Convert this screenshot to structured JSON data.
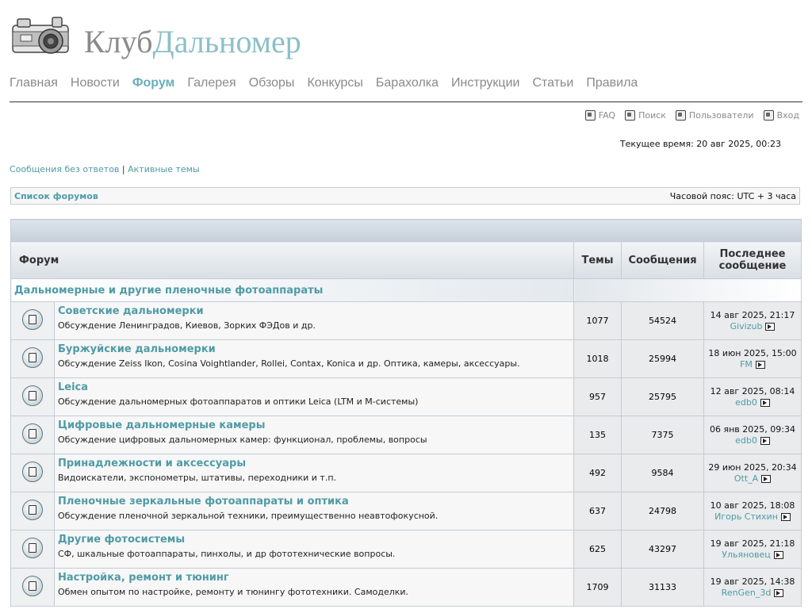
{
  "site": {
    "logo_part1": "Клуб",
    "logo_part2": "Дальномер"
  },
  "nav": [
    {
      "label": "Главная"
    },
    {
      "label": "Новости"
    },
    {
      "label": "Форум",
      "active": true
    },
    {
      "label": "Галерея"
    },
    {
      "label": "Обзоры"
    },
    {
      "label": "Конкурсы"
    },
    {
      "label": "Барахолка"
    },
    {
      "label": "Инструкции"
    },
    {
      "label": "Статьи"
    },
    {
      "label": "Правила"
    }
  ],
  "toplinks": {
    "faq": "FAQ",
    "search": "Поиск",
    "users": "Пользователи",
    "login": "Вход"
  },
  "current_time": "Текущее время: 20 авг 2025, 00:23",
  "quick_links": {
    "unanswered": "Сообщения без ответов",
    "separator": "|",
    "active": "Активные темы"
  },
  "navbar": {
    "forum_list": "Список форумов",
    "timezone": "Часовой пояс: UTC + 3 часа"
  },
  "table": {
    "headers": {
      "forum": "Форум",
      "topics": "Темы",
      "posts": "Сообщения",
      "last_post": "Последнее сообщение"
    },
    "category": "Дальномерные и другие пленочные фотоаппараты",
    "forums": [
      {
        "title": "Советские дальномерки",
        "desc": "Обсуждение Ленинградов, Киевов, Зорких ФЭДов и др.",
        "topics": "1077",
        "posts": "54524",
        "last_date": "14 авг 2025, 21:17",
        "last_user": "Givizub"
      },
      {
        "title": "Буржуйские дальномерки",
        "desc": "Обсуждение Zeiss Ikon, Cosina Voightlander, Rollei, Contax, Konica и др. Оптика, камеры, аксессуары.",
        "topics": "1018",
        "posts": "25994",
        "last_date": "18 июн 2025, 15:00",
        "last_user": "FM"
      },
      {
        "title": "Leica",
        "desc": "Обсуждение дальномерных фотоаппаратов и оптики Leica (LTM и M-системы)",
        "topics": "957",
        "posts": "25795",
        "last_date": "12 авг 2025, 08:14",
        "last_user": "edb0"
      },
      {
        "title": "Цифровые дальномерные камеры",
        "desc": "Обсуждение цифровых дальномерных камер: функционал, проблемы, вопросы",
        "topics": "135",
        "posts": "7375",
        "last_date": "06 янв 2025, 09:34",
        "last_user": "edb0"
      },
      {
        "title": "Принадлежности и аксессуары",
        "desc": "Видоискатели, экспонометры, штативы, переходники и т.п.",
        "topics": "492",
        "posts": "9584",
        "last_date": "29 июн 2025, 20:34",
        "last_user": "Ott_A"
      },
      {
        "title": "Пленочные зеркальные фотоаппараты и оптика",
        "desc": "Обсуждение пленочной зеркальной техники, преимущественно неавтофокусной.",
        "topics": "637",
        "posts": "24798",
        "last_date": "10 авг 2025, 18:08",
        "last_user": "Игорь Стихин"
      },
      {
        "title": "Другие фотосистемы",
        "desc": "СФ, шкальные фотоаппараты, пинхолы, и др фототехнические вопросы.",
        "topics": "625",
        "posts": "43297",
        "last_date": "19 авг 2025, 21:18",
        "last_user": "Ульяновец"
      },
      {
        "title": "Настройка, ремонт и тюнинг",
        "desc": "Обмен опытом по настройке, ремонту и тюнингу фототехники. Самоделки.",
        "topics": "1709",
        "posts": "31133",
        "last_date": "19 авг 2025, 14:38",
        "last_user": "RenGen_3d"
      }
    ]
  }
}
